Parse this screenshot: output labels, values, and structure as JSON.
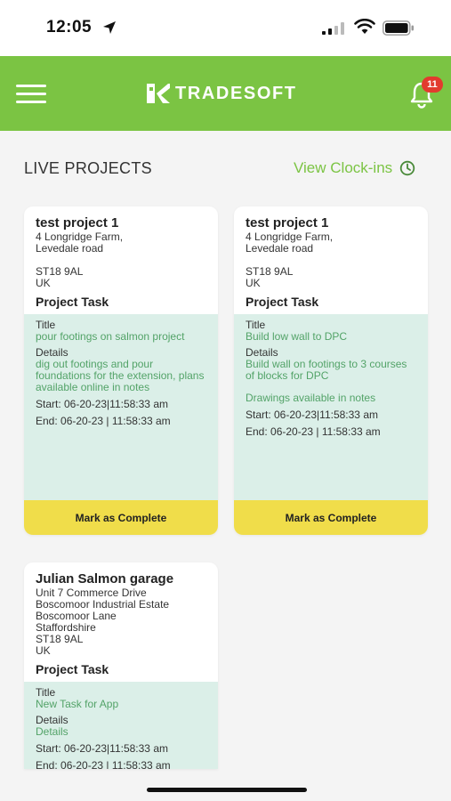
{
  "status_bar": {
    "time": "12:05"
  },
  "header": {
    "brand": "TRADESOFT",
    "notification_count": "11"
  },
  "section": {
    "title": "LIVE PROJECTS",
    "clockins_label": "View Clock-ins"
  },
  "projects": [
    {
      "name": "test project 1",
      "address_line1": "4 Longridge Farm,",
      "address_line2": "Levedale road",
      "postcode": "ST18 9AL",
      "country": "UK",
      "task_header": "Project Task",
      "title_label": "Title",
      "title_value": "pour footings on salmon project",
      "details_label": "Details",
      "details_value": "dig out footings and pour foundations for the extension, plans available online in notes",
      "start": "Start: 06-20-23|11:58:33 am",
      "end": "End: 06-20-23 | 11:58:33 am",
      "button": "Mark as Complete"
    },
    {
      "name": "test project 1",
      "address_line1": "4 Longridge Farm,",
      "address_line2": "Levedale road",
      "postcode": "ST18 9AL",
      "country": "UK",
      "task_header": "Project Task",
      "title_label": "Title",
      "title_value": "Build low wall to DPC",
      "details_label": "Details",
      "details_value": "Build wall on footings to 3 courses of blocks for DPC",
      "details_extra": "Drawings available in notes",
      "start": "Start: 06-20-23|11:58:33 am",
      "end": "End: 06-20-23 | 11:58:33 am",
      "button": "Mark as Complete"
    },
    {
      "name": "Julian Salmon garage",
      "address_line1": "Unit 7 Commerce Drive",
      "address_line2": "Boscomoor Industrial Estate",
      "address_line3": "Boscomoor Lane",
      "address_line4": "Staffordshire",
      "postcode": "ST18 9AL",
      "country": "UK",
      "task_header": "Project Task",
      "title_label": "Title",
      "title_value": "New Task for App",
      "details_label": "Details",
      "details_value": "Details",
      "start": "Start: 06-20-23|11:58:33 am",
      "end": "End: 06-20-23 | 11:58:33 am"
    }
  ],
  "colors": {
    "brand_green": "#7bc443",
    "task_bg": "#dbefe8",
    "button_yellow": "#f0dd4a",
    "badge_red": "#e23b2e"
  }
}
